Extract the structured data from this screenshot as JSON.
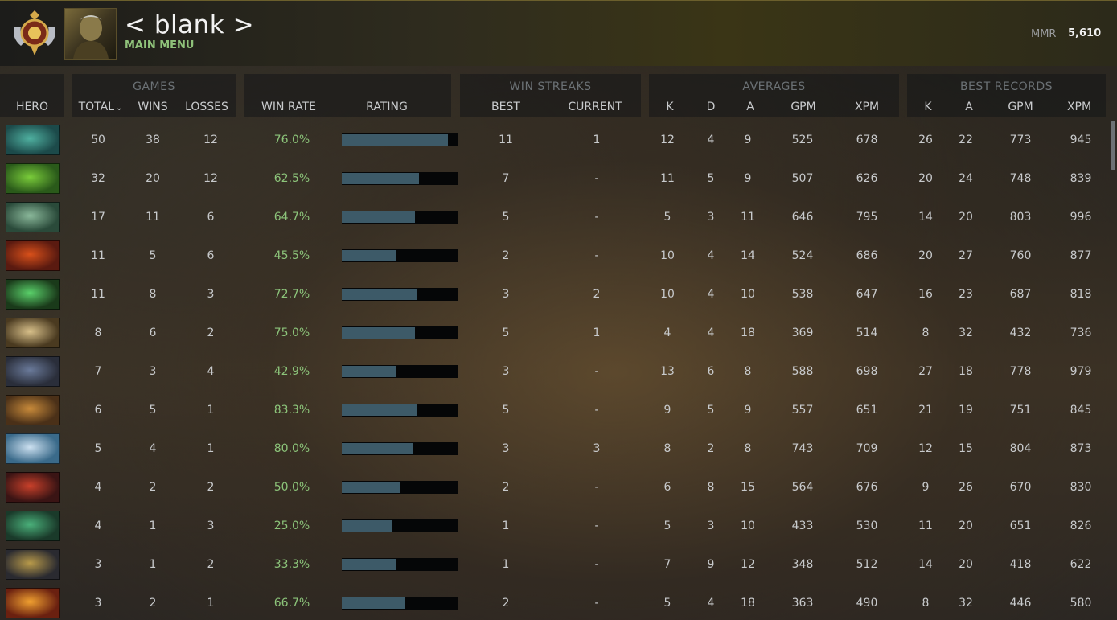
{
  "profile": {
    "name": "< blank >",
    "subtitle": "MAIN MENU",
    "mmr_label": "MMR",
    "mmr_value": "5,610"
  },
  "header": {
    "hero": "HERO",
    "games_title": "GAMES",
    "total": "TOTAL",
    "wins": "WINS",
    "losses": "LOSSES",
    "win_rate": "WIN RATE",
    "rating": "RATING",
    "streaks_title": "WIN STREAKS",
    "best": "BEST",
    "current": "CURRENT",
    "averages_title": "AVERAGES",
    "k": "K",
    "d": "D",
    "a": "A",
    "gpm": "GPM",
    "xpm": "XPM",
    "records_title": "BEST RECORDS",
    "rk": "K",
    "ra": "A",
    "rgpm": "GPM",
    "rxpm": "XPM"
  },
  "colors": {
    "win_rate_text": "#8cc47a",
    "rating_fill": "#3d5a68",
    "rating_track": "#050607"
  },
  "rows": [
    {
      "hero_icon": "hero-1-icon",
      "total": "50",
      "wins": "38",
      "losses": "12",
      "win_rate": "76.0%",
      "rating": 0.91,
      "best": "11",
      "current": "1",
      "k": "12",
      "d": "4",
      "a": "9",
      "gpm": "525",
      "xpm": "678",
      "rk": "26",
      "ra": "22",
      "rgpm": "773",
      "rxpm": "945"
    },
    {
      "hero_icon": "hero-2-icon",
      "total": "32",
      "wins": "20",
      "losses": "12",
      "win_rate": "62.5%",
      "rating": 0.66,
      "best": "7",
      "current": "-",
      "k": "11",
      "d": "5",
      "a": "9",
      "gpm": "507",
      "xpm": "626",
      "rk": "20",
      "ra": "24",
      "rgpm": "748",
      "rxpm": "839"
    },
    {
      "hero_icon": "hero-3-icon",
      "total": "17",
      "wins": "11",
      "losses": "6",
      "win_rate": "64.7%",
      "rating": 0.63,
      "best": "5",
      "current": "-",
      "k": "5",
      "d": "3",
      "a": "11",
      "gpm": "646",
      "xpm": "795",
      "rk": "14",
      "ra": "20",
      "rgpm": "803",
      "rxpm": "996"
    },
    {
      "hero_icon": "hero-4-icon",
      "total": "11",
      "wins": "5",
      "losses": "6",
      "win_rate": "45.5%",
      "rating": 0.47,
      "best": "2",
      "current": "-",
      "k": "10",
      "d": "4",
      "a": "14",
      "gpm": "524",
      "xpm": "686",
      "rk": "20",
      "ra": "27",
      "rgpm": "760",
      "rxpm": "877"
    },
    {
      "hero_icon": "hero-5-icon",
      "total": "11",
      "wins": "8",
      "losses": "3",
      "win_rate": "72.7%",
      "rating": 0.65,
      "best": "3",
      "current": "2",
      "k": "10",
      "d": "4",
      "a": "10",
      "gpm": "538",
      "xpm": "647",
      "rk": "16",
      "ra": "23",
      "rgpm": "687",
      "rxpm": "818"
    },
    {
      "hero_icon": "hero-6-icon",
      "total": "8",
      "wins": "6",
      "losses": "2",
      "win_rate": "75.0%",
      "rating": 0.63,
      "best": "5",
      "current": "1",
      "k": "4",
      "d": "4",
      "a": "18",
      "gpm": "369",
      "xpm": "514",
      "rk": "8",
      "ra": "32",
      "rgpm": "432",
      "rxpm": "736"
    },
    {
      "hero_icon": "hero-7-icon",
      "total": "7",
      "wins": "3",
      "losses": "4",
      "win_rate": "42.9%",
      "rating": 0.47,
      "best": "3",
      "current": "-",
      "k": "13",
      "d": "6",
      "a": "8",
      "gpm": "588",
      "xpm": "698",
      "rk": "27",
      "ra": "18",
      "rgpm": "778",
      "rxpm": "979"
    },
    {
      "hero_icon": "hero-8-icon",
      "total": "6",
      "wins": "5",
      "losses": "1",
      "win_rate": "83.3%",
      "rating": 0.64,
      "best": "5",
      "current": "-",
      "k": "9",
      "d": "5",
      "a": "9",
      "gpm": "557",
      "xpm": "651",
      "rk": "21",
      "ra": "19",
      "rgpm": "751",
      "rxpm": "845"
    },
    {
      "hero_icon": "hero-9-icon",
      "total": "5",
      "wins": "4",
      "losses": "1",
      "win_rate": "80.0%",
      "rating": 0.61,
      "best": "3",
      "current": "3",
      "k": "8",
      "d": "2",
      "a": "8",
      "gpm": "743",
      "xpm": "709",
      "rk": "12",
      "ra": "15",
      "rgpm": "804",
      "rxpm": "873"
    },
    {
      "hero_icon": "hero-10-icon",
      "total": "4",
      "wins": "2",
      "losses": "2",
      "win_rate": "50.0%",
      "rating": 0.5,
      "best": "2",
      "current": "-",
      "k": "6",
      "d": "8",
      "a": "15",
      "gpm": "564",
      "xpm": "676",
      "rk": "9",
      "ra": "26",
      "rgpm": "670",
      "rxpm": "830"
    },
    {
      "hero_icon": "hero-11-icon",
      "total": "4",
      "wins": "1",
      "losses": "3",
      "win_rate": "25.0%",
      "rating": 0.43,
      "best": "1",
      "current": "-",
      "k": "5",
      "d": "3",
      "a": "10",
      "gpm": "433",
      "xpm": "530",
      "rk": "11",
      "ra": "20",
      "rgpm": "651",
      "rxpm": "826"
    },
    {
      "hero_icon": "hero-12-icon",
      "total": "3",
      "wins": "1",
      "losses": "2",
      "win_rate": "33.3%",
      "rating": 0.47,
      "best": "1",
      "current": "-",
      "k": "7",
      "d": "9",
      "a": "12",
      "gpm": "348",
      "xpm": "512",
      "rk": "14",
      "ra": "20",
      "rgpm": "418",
      "rxpm": "622"
    },
    {
      "hero_icon": "hero-13-icon",
      "total": "3",
      "wins": "2",
      "losses": "1",
      "win_rate": "66.7%",
      "rating": 0.54,
      "best": "2",
      "current": "-",
      "k": "5",
      "d": "4",
      "a": "18",
      "gpm": "363",
      "xpm": "490",
      "rk": "8",
      "ra": "32",
      "rgpm": "446",
      "rxpm": "580"
    }
  ]
}
